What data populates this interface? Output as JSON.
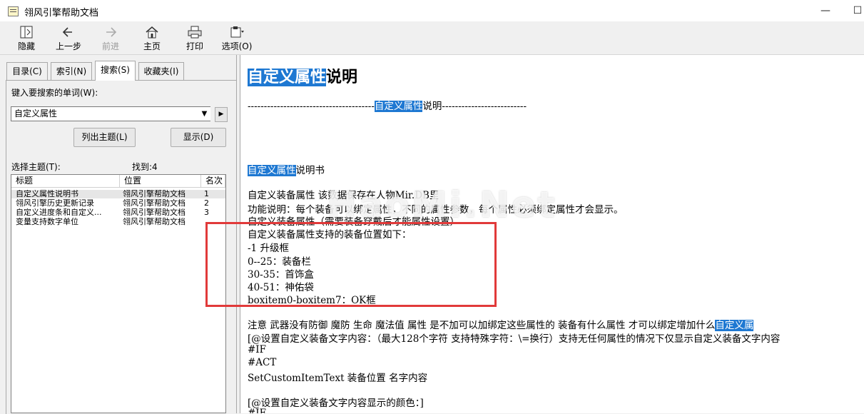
{
  "window": {
    "title": "翎风引擎帮助文档"
  },
  "toolbar": {
    "hide_label": "隐藏",
    "back_label": "上一步",
    "forward_label": "前进",
    "home_label": "主页",
    "print_label": "打印",
    "options_label": "选项(O)"
  },
  "tabs": [
    {
      "label": "目录(C)"
    },
    {
      "label": "索引(N)"
    },
    {
      "label": "搜索(S)"
    },
    {
      "label": "收藏夹(I)"
    }
  ],
  "search": {
    "prompt": "键入要搜索的单词(W):",
    "value": "自定义属性",
    "list_topics_label": "列出主题(L)",
    "display_label": "显示(D)",
    "select_topic_label": "选择主题(T):",
    "found_label": "找到:4"
  },
  "results": {
    "columns": [
      "标题",
      "位置",
      "名次"
    ],
    "rows": [
      {
        "title": "自定义属性说明书",
        "location": "翎风引擎帮助文档",
        "rank": "1"
      },
      {
        "title": "翎风引擎历史更新记录",
        "location": "翎风引擎帮助文档",
        "rank": "2"
      },
      {
        "title": "自定义进度条和自定义...",
        "location": "翎风引擎帮助文档",
        "rank": "3"
      },
      {
        "title": "变量支持数字单位",
        "location": "翎风引擎帮助文档",
        "rank": ""
      }
    ]
  },
  "content": {
    "heading_hl": "自定义属性",
    "heading_rest": "说明",
    "divider_left": "---------------------------------------",
    "divider_hl": "自定义属性",
    "divider_mid": "说明",
    "divider_right": "--------------------------",
    "manual_hl": "自定义属性",
    "manual_rest": "说明书",
    "para1": "自定义装备属性 该数据保存在人物Mir.DB里",
    "para2": "功能说明：每个装备可以绑定属性，不同的属性参数，每个属性必须绑定属性才会显示。",
    "para3": "自定义装备属性（需要装备穿戴后才能属性设置）",
    "pos_title": "自定义装备属性支持的装备位置如下：",
    "pos1": "-1 升级框",
    "pos2": "0--25：装备栏",
    "pos3": "30-35：首饰盒",
    "pos4": "40-51：神佑袋",
    "pos5": "boxitem0-boxitem7：OK框",
    "note": "注意 武器没有防御 魔防 生命 魔法值 属性 是不加可以加绑定这些属性的 装备有什么属性 才可以绑定增加什么",
    "note_hl": "自定义属",
    "cmd1": "[@设置自定义装备文字内容：（最大128个字符 支持特殊字符：\\=换行）支持无任何属性的情况下仅显示自定义装备文字内容",
    "cmd2": "#IF",
    "cmd3": "#ACT",
    "cmd4": "SetCustomItemText 装备位置 名字内容",
    "cmd5": "[@设置自定义装备文字内容显示的颜色：]",
    "cmd6": "#IF"
  },
  "watermark": "HaoMi.Net"
}
